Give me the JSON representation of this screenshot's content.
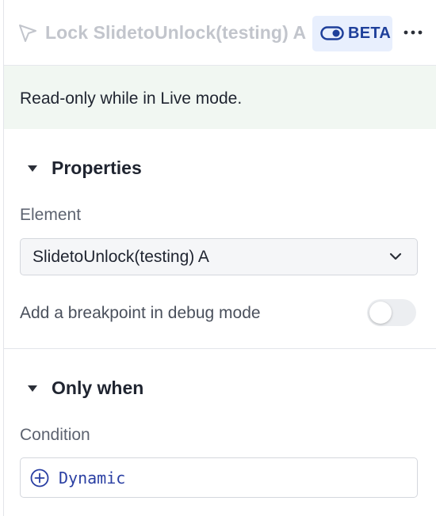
{
  "header": {
    "icon": "cursor-arrow-icon",
    "title": "Lock SlidetoUnlock(testing) A",
    "beta_label": "BETA",
    "beta_icon": "toggle-icon",
    "more_icon": "more-horizontal-icon"
  },
  "notice": {
    "text": "Read-only while in Live mode."
  },
  "properties": {
    "title": "Properties",
    "element_label": "Element",
    "element_value": "SlidetoUnlock(testing) A",
    "breakpoint_label": "Add a breakpoint in debug mode",
    "breakpoint_on": false
  },
  "only_when": {
    "title": "Only when",
    "condition_label": "Condition",
    "dynamic_label": "Dynamic"
  },
  "colors": {
    "accent": "#1e3f9a",
    "notice_bg": "#f1f7f2",
    "beta_bg": "#e8effd",
    "dynamic_text": "#2a3fa3"
  }
}
